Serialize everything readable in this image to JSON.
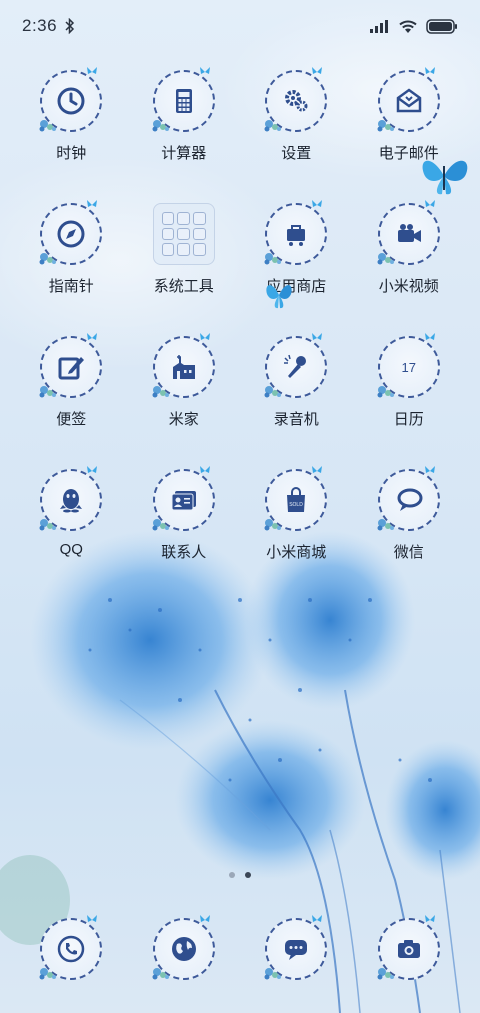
{
  "status_bar": {
    "time": "2:36",
    "icons": [
      "bluetooth-icon",
      "signal-icon",
      "wifi-icon",
      "battery-icon"
    ]
  },
  "apps": [
    {
      "label": "时钟",
      "icon": "clock-icon"
    },
    {
      "label": "计算器",
      "icon": "calculator-icon"
    },
    {
      "label": "设置",
      "icon": "gear-icon"
    },
    {
      "label": "电子邮件",
      "icon": "mail-icon"
    },
    {
      "label": "指南针",
      "icon": "compass-icon"
    },
    {
      "label": "系统工具",
      "icon": "folder-icon"
    },
    {
      "label": "应用商店",
      "icon": "cart-icon"
    },
    {
      "label": "小米视频",
      "icon": "video-camera-icon"
    },
    {
      "label": "便签",
      "icon": "note-edit-icon"
    },
    {
      "label": "米家",
      "icon": "house-icon"
    },
    {
      "label": "录音机",
      "icon": "microphone-icon"
    },
    {
      "label": "日历",
      "icon": "calendar-icon",
      "date": "17"
    },
    {
      "label": "QQ",
      "icon": "penguin-icon"
    },
    {
      "label": "联系人",
      "icon": "contacts-card-icon"
    },
    {
      "label": "小米商城",
      "icon": "shopping-bag-icon",
      "bag_text": "SOLD"
    },
    {
      "label": "微信",
      "icon": "chat-bubble-icon"
    }
  ],
  "page_indicator": {
    "count": 2,
    "active_index": 1
  },
  "dock": [
    {
      "icon": "phone-icon"
    },
    {
      "icon": "browser-globe-icon"
    },
    {
      "icon": "message-icon"
    },
    {
      "icon": "camera-icon"
    }
  ],
  "colors": {
    "icon_ring": "#3e5a9a",
    "glyph": "#2f4e8e",
    "label": "#1c2430",
    "butterfly": "#3aa7e6"
  }
}
